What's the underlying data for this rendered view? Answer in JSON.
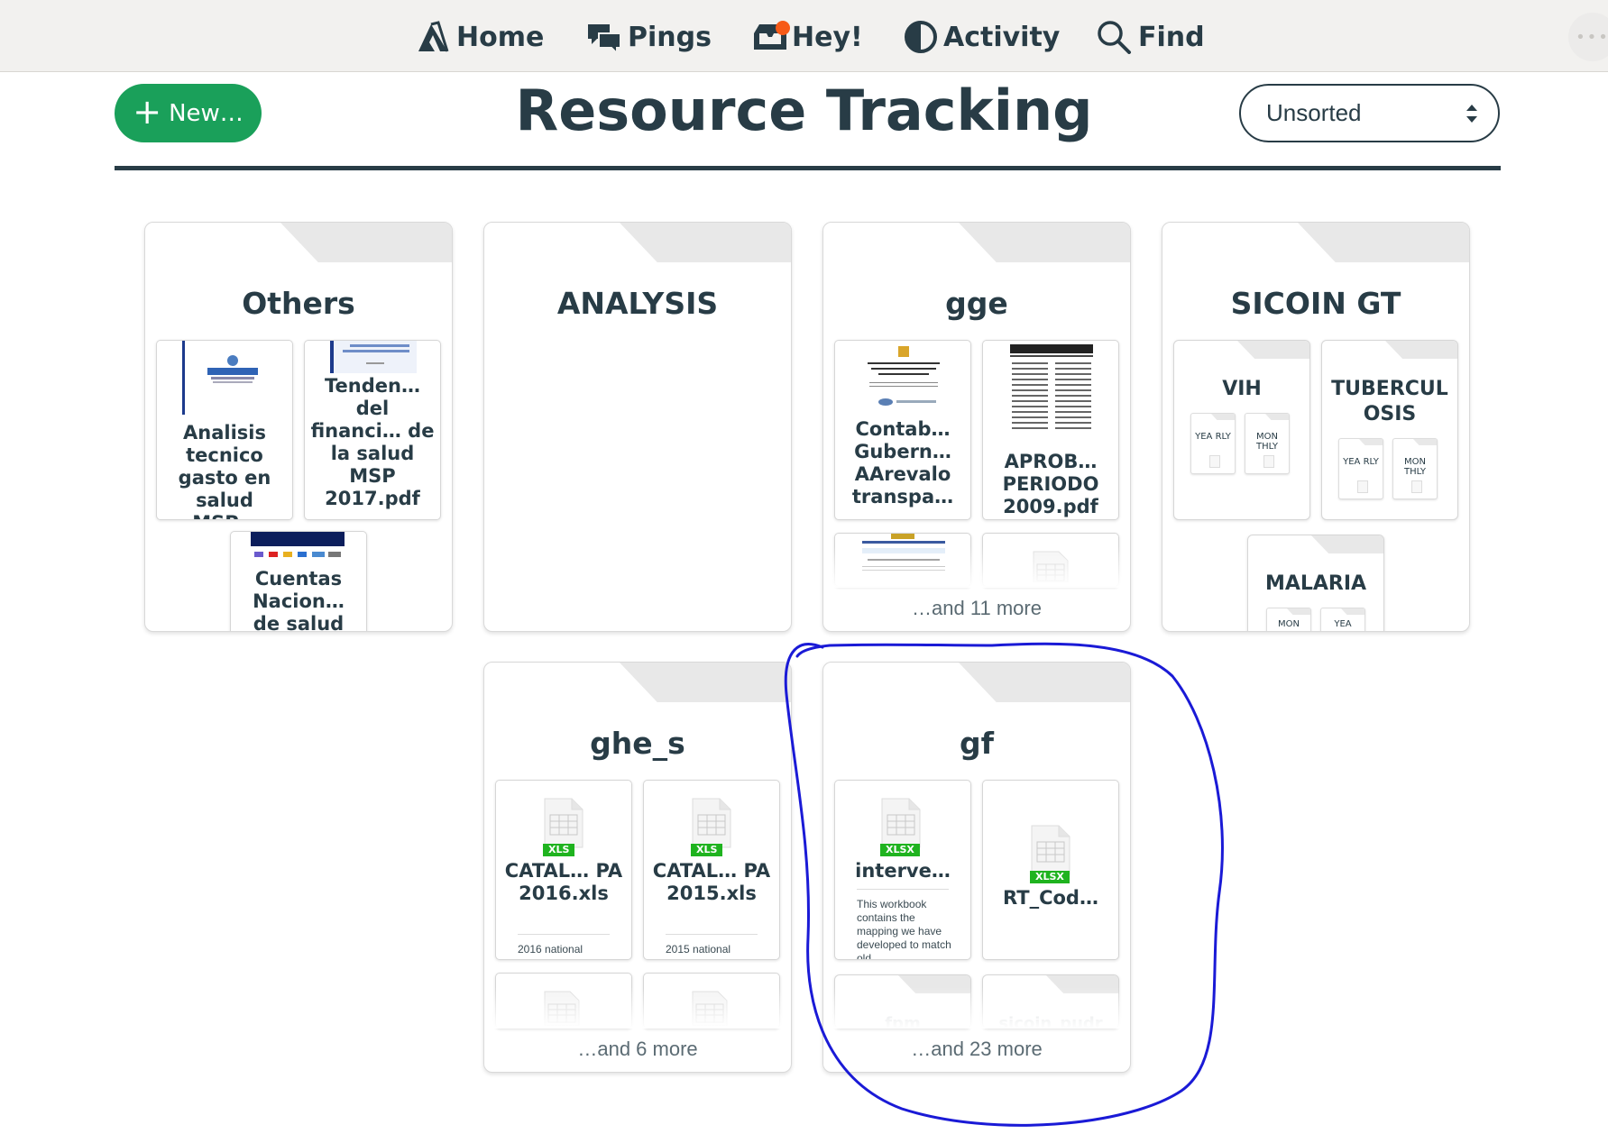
{
  "nav": {
    "items": [
      {
        "label": "Home",
        "icon": "home-icon"
      },
      {
        "label": "Pings",
        "icon": "pings-icon"
      },
      {
        "label": "Hey!",
        "icon": "hey-icon",
        "badge_color": "#f75a17"
      },
      {
        "label": "Activity",
        "icon": "activity-icon"
      },
      {
        "label": "Find",
        "icon": "search-icon"
      }
    ],
    "more_label": "•••"
  },
  "toolbar": {
    "new_label": "New…",
    "new_plus": "+",
    "title": "Resource Tracking",
    "sort_value": "Unsorted"
  },
  "colors": {
    "primary_text": "#283c46",
    "new_button": "#1aa05a",
    "xls_badge": "#1fb31f",
    "annotation": "#1a1ad6"
  },
  "folders": {
    "others": {
      "title": "Others",
      "cards": [
        {
          "title": "Analisis tecnico gasto en salud MSP..."
        },
        {
          "title": "Tenden… del financi… de la salud MSP 2017.pdf"
        },
        {
          "title": "Cuentas Nacion… de salud"
        }
      ]
    },
    "analysis": {
      "title": "ANALYSIS"
    },
    "gge": {
      "title": "gge",
      "cards": [
        {
          "title": "Contab… Gubern… AArevalo transpa…"
        },
        {
          "title": "APROB… PERIODO 2009.pdf"
        }
      ],
      "more": "…and 11 more"
    },
    "sicoin": {
      "title": "SICOIN GT",
      "subfolders": [
        {
          "title": "VIH",
          "minis": [
            "YEA RLY",
            "MON THLY"
          ]
        },
        {
          "title": "TUBERCUL OSIS",
          "minis": [
            "YEA RLY",
            "MON THLY"
          ]
        },
        {
          "title": "MALARIA",
          "minis": [
            "MON",
            "YEA"
          ]
        }
      ]
    },
    "ghe_s": {
      "title": "ghe_s",
      "cards": [
        {
          "title": "CATAL… PA 2016.xls",
          "badge": "XLS",
          "desc": "2016 national"
        },
        {
          "title": "CATAL… PA 2015.xls",
          "badge": "XLS",
          "desc": "2015 national"
        }
      ],
      "more": "…and 6 more"
    },
    "gf": {
      "title": "gf",
      "cards": [
        {
          "title": "interve…",
          "badge": "XLSX",
          "desc": "This workbook contains the mapping we have developed to match old"
        },
        {
          "title": "RT_Cod…",
          "badge": "XLSX"
        }
      ],
      "subfolders": [
        {
          "title": "fpm"
        },
        {
          "title": "sicoin_pudr"
        }
      ],
      "more": "…and 23 more"
    }
  }
}
